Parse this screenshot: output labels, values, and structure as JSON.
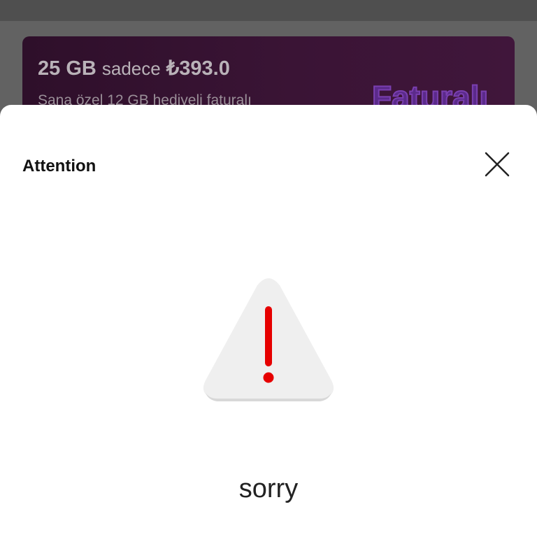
{
  "promo": {
    "amount": "25 GB",
    "word": "sadece",
    "price": "₺393.0",
    "subtitle": "Sana özel 12 GB hediyeli faturalı",
    "brand": "Faturalı"
  },
  "dialog": {
    "title": "Attention",
    "close_icon": "close-icon",
    "warning_icon": "warning-triangle-icon",
    "message": "sorry",
    "accent_color": "#e60000"
  }
}
